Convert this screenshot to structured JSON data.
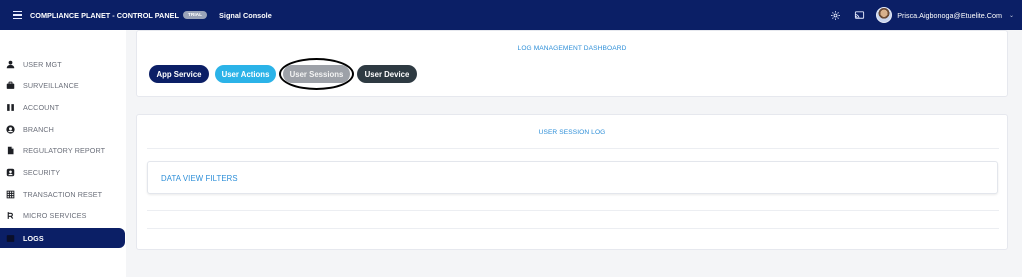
{
  "topbar": {
    "brand": "COMPLIANCE PLANET - CONTROL PANEL",
    "badge": "TRIAL",
    "console": "Signal Console",
    "user_email": "Prisca.Aigbonoga@Etuelite.Com"
  },
  "sidebar": {
    "items": [
      {
        "label": "USER MGT",
        "icon": "user-icon"
      },
      {
        "label": "SURVEILLANCE",
        "icon": "briefcase-icon"
      },
      {
        "label": "ACCOUNT",
        "icon": "book-icon"
      },
      {
        "label": "BRANCH",
        "icon": "user-circle-icon"
      },
      {
        "label": "REGULATORY REPORT",
        "icon": "file-icon"
      },
      {
        "label": "SECURITY",
        "icon": "shield-icon"
      },
      {
        "label": "TRANSACTION RESET",
        "icon": "grid-icon"
      },
      {
        "label": "MICRO SERVICES",
        "icon": "microservice-icon"
      },
      {
        "label": "LOGS",
        "icon": "logs-icon"
      }
    ],
    "active": "LOGS"
  },
  "dashboard": {
    "title": "LOG MANAGEMENT DASHBOARD",
    "buttons": {
      "app_service": "App Service",
      "user_actions": "User Actions",
      "user_sessions": "User Sessions",
      "user_device": "User Device"
    }
  },
  "session_log": {
    "title": "USER SESSION LOG",
    "filters_label": "DATA VIEW FILTERS"
  },
  "colors": {
    "navy": "#0b1f66",
    "cyan": "#2bb3e8",
    "grey": "#9da1a8",
    "dark": "#2e3a42",
    "link_blue": "#2e8fd8"
  }
}
